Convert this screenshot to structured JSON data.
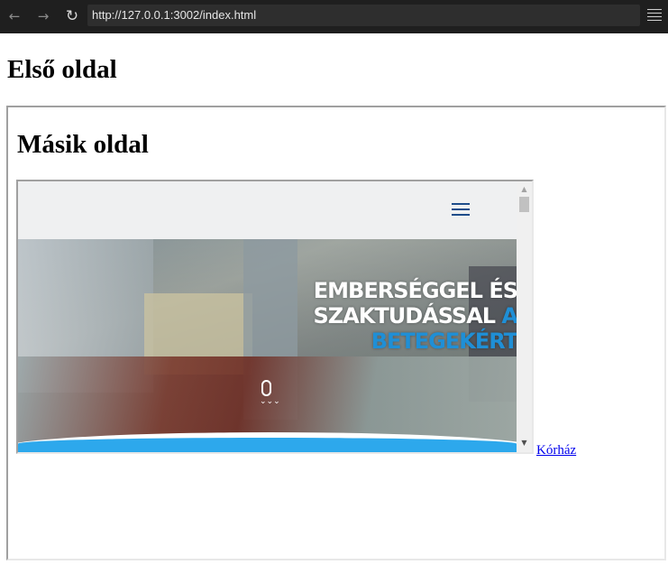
{
  "browser": {
    "back_icon": "←",
    "forward_icon": "→",
    "reload_icon": "↻",
    "url": "http://127.0.0.1:3002/index.html"
  },
  "page": {
    "title": "Első oldal"
  },
  "outer_frame": {
    "title": "Másik oldal",
    "link_text": "Kórház"
  },
  "inner_site": {
    "hero_line1": "EMBERSÉGGEL ÉS",
    "hero_line2_white": "SZAKTUDÁSSAL ",
    "hero_line2_accent": "A",
    "hero_line3": "BETEGEKÉRT",
    "scroll_chevrons": "⌄⌄⌄",
    "accent_color": "#1f8fd6",
    "band_color": "#2da8ec",
    "menu_icon_color": "#1d4c8a"
  },
  "scrollbar": {
    "up_arrow": "▲",
    "down_arrow": "▼"
  }
}
